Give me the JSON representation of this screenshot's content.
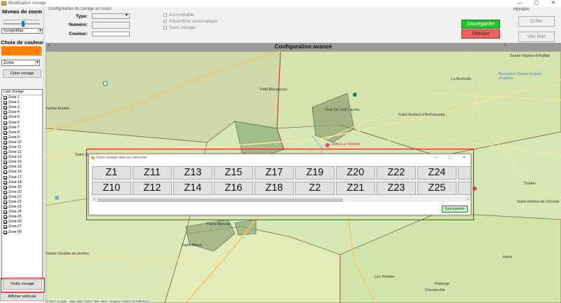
{
  "window": {
    "title": "Modification zonage",
    "min_glyph": "—",
    "max_glyph": "▢",
    "close_glyph": "✕"
  },
  "left_panel": {
    "zoom_label": "Niveau de zoom",
    "map_type_value": "GoogleMap",
    "color_label": "Choix de couleur",
    "color_value": "#ff7f00",
    "zone_select_value": "Zone",
    "create_zone_label": "Créer zonage",
    "list_header": "Liste Zonage",
    "zones": [
      "Zone-1",
      "Zone-2",
      "Zone-3",
      "Zone-4",
      "Zone-5",
      "Zone-6",
      "Zone-7",
      "Zone-8",
      "Zone-9",
      "Zone-10",
      "Zone-11",
      "Zone-12",
      "Zone-13",
      "Zone-14",
      "Zone-15",
      "Zone-16",
      "Zone-17",
      "Zone-18",
      "Zone-19",
      "Zone-20",
      "Zone-21",
      "Zone-22",
      "Zone-23",
      "Zone-24",
      "Zone-25",
      "Zone-26",
      "Zone-27",
      "Zone-99"
    ],
    "order_zone_label": "Ordre zonage",
    "show_vehicle_label": "Afficher véhicule"
  },
  "config": {
    "group_title": "Configuration du zonage en cours",
    "type_label": "Type:",
    "numero_label": "Numéro:",
    "couleur_label": "Couleur:",
    "accrochable_label": "Accrochable",
    "repartition_label": "Répartition automatique",
    "sous_zonage_label": "Sous zonage",
    "save_label": "Sauvegarder",
    "destroy_label": "Détruire"
  },
  "horaire": {
    "title": "Horaire",
    "create_label": "Créer",
    "view_list_label": "Voir liste"
  },
  "advanced_bar": {
    "title": "Configuration avancé",
    "star": "*"
  },
  "map": {
    "places": [
      {
        "name": "Sainte-Sophie-d'Halifax",
        "kind": "dark"
      },
      {
        "name": "Belvedere Sainte-Sophie-d'Halifax",
        "kind": "blue"
      },
      {
        "name": "La Rochelle",
        "kind": "dark"
      },
      {
        "name": "Petit-Bécancour",
        "kind": "dark"
      },
      {
        "name": "Sainte-Eulalie",
        "kind": "dark"
      },
      {
        "name": "Club De Golf Laurier",
        "kind": "dark"
      },
      {
        "name": "Saint-Norbert-d'Arthabaska",
        "kind": "dark"
      },
      {
        "name": "Hôtel Le Victorin",
        "kind": "red"
      },
      {
        "name": "Saint-Samuel",
        "kind": "dark"
      },
      {
        "name": "Trottier",
        "kind": "dark"
      },
      {
        "name": "Saint-Hélène-de-Chester",
        "kind": "dark"
      },
      {
        "name": "Place-Bérubé",
        "kind": "dark"
      },
      {
        "name": "Saint-Albert",
        "kind": "dark"
      },
      {
        "name": "Sainte-Clotilde-de-Horton",
        "kind": "dark"
      },
      {
        "name": "Héon",
        "kind": "dark"
      },
      {
        "name": "Les Pointes",
        "kind": "dark"
      },
      {
        "name": "Roberge",
        "kind": "dark"
      },
      {
        "name": "Chesterville",
        "kind": "dark"
      }
    ],
    "credits": "©2023 Google - Map data ©2023 Tele Atlas, Imagery ©2023 TerraMetrics"
  },
  "dialog": {
    "title": "Ordre zonage dans les véhicules",
    "row1": [
      "Z1",
      "Z11",
      "Z13",
      "Z15",
      "Z17",
      "Z19",
      "Z20",
      "Z22",
      "Z24",
      "Z"
    ],
    "row2": [
      "Z10",
      "Z12",
      "Z14",
      "Z16",
      "Z18",
      "Z2",
      "Z21",
      "Z23",
      "Z25",
      "Z"
    ],
    "save_label": "Sauvegarder",
    "scroll_left": "<",
    "scroll_right": ">",
    "min_glyph": "—",
    "max_glyph": "▢",
    "close_glyph": "✕"
  },
  "colors": {
    "accent_green": "#21c42a",
    "destroy_red": "#f06262",
    "highlight_red": "#dd1111",
    "map_green": "#d6e8b5",
    "zone_brown": "#b9a777"
  }
}
